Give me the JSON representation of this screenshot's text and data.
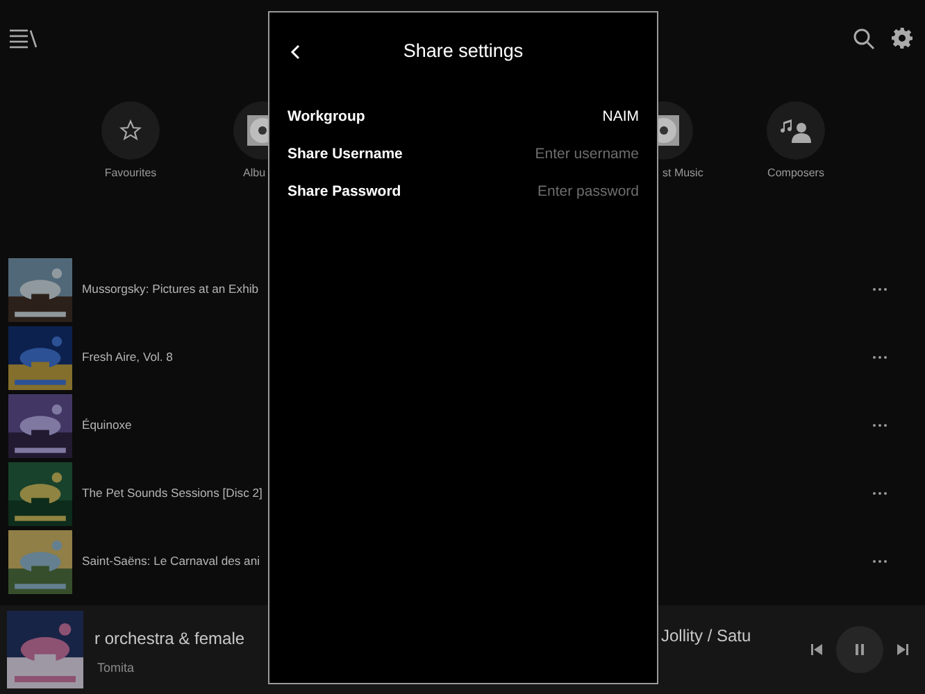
{
  "categories": [
    {
      "kind": "favourites",
      "label": "Favourites"
    },
    {
      "kind": "album",
      "label": "Albu"
    },
    {
      "kind": "album",
      "label": "st Music"
    },
    {
      "kind": "composers",
      "label": "Composers"
    }
  ],
  "albums": [
    {
      "title": "Mussorgsky: Pictures at an Exhib"
    },
    {
      "title": "Fresh Aire, Vol. 8"
    },
    {
      "title": "Équinoxe"
    },
    {
      "title": "The Pet Sounds Sessions [Disc 2]"
    },
    {
      "title": "Saint-Saëns: Le Carnaval des ani"
    }
  ],
  "now_playing": {
    "title_left": "r orchestra & female",
    "title_right": "Jollity / Satu",
    "artist": "Tomita"
  },
  "dialog": {
    "title": "Share settings",
    "fields": [
      {
        "label": "Workgroup",
        "value": "NAIM"
      },
      {
        "label": "Share Username",
        "placeholder": "Enter username"
      },
      {
        "label": "Share Password",
        "placeholder": "Enter password"
      }
    ]
  }
}
